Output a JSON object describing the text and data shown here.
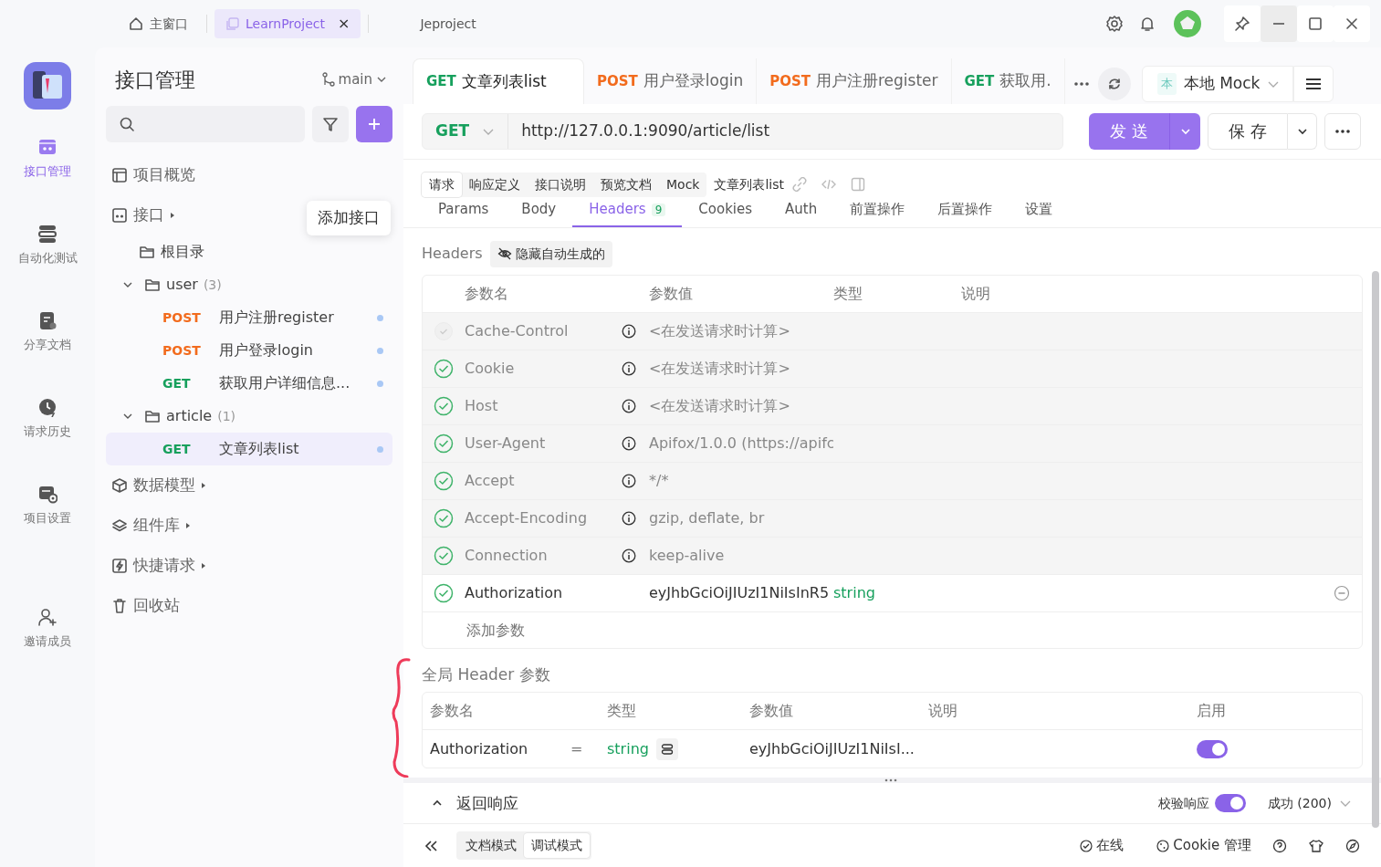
{
  "window_tabs": [
    {
      "label": "主窗口",
      "selected": false,
      "closable": false
    },
    {
      "label": "LearnProject",
      "selected": true,
      "closable": true
    },
    {
      "label": "Jeproject",
      "selected": false,
      "closable": false
    }
  ],
  "close_glyph": "×",
  "rail": [
    {
      "label": "接口管理",
      "selected": true
    },
    {
      "label": "自动化测试",
      "selected": false
    },
    {
      "label": "分享文档",
      "selected": false
    },
    {
      "label": "请求历史",
      "selected": false
    },
    {
      "label": "项目设置",
      "selected": false
    },
    {
      "label": "邀请成员",
      "selected": false
    }
  ],
  "tree_panel": {
    "title": "接口管理",
    "branch": "main",
    "tooltip": "添加接口",
    "sections": [
      {
        "label": "项目概览",
        "caret": false
      },
      {
        "label": "接口",
        "caret": true,
        "children": [
          {
            "kind": "folder",
            "label": "根目录"
          },
          {
            "kind": "folder",
            "label": "user",
            "count": "(3)",
            "expanded": true,
            "children": [
              {
                "kind": "endpoint",
                "method": "POST",
                "color": "#f26b1d",
                "label": "用户注册register",
                "selected": false
              },
              {
                "kind": "endpoint",
                "method": "POST",
                "color": "#f26b1d",
                "label": "用户登录login",
                "selected": false
              },
              {
                "kind": "endpoint",
                "method": "GET",
                "color": "#17a05d",
                "label": "获取用户详细信息...",
                "selected": false
              }
            ]
          },
          {
            "kind": "folder",
            "label": "article",
            "count": "(1)",
            "expanded": true,
            "children": [
              {
                "kind": "endpoint",
                "method": "GET",
                "color": "#17a05d",
                "label": "文章列表list",
                "selected": true
              }
            ]
          }
        ]
      },
      {
        "label": "数据模型",
        "caret": true
      },
      {
        "label": "组件库",
        "caret": true
      },
      {
        "label": "快捷请求",
        "caret": true
      },
      {
        "label": "回收站",
        "caret": false
      }
    ]
  },
  "request_tabs": [
    {
      "method": "GET",
      "color": "#17a05d",
      "label": "文章列表list",
      "selected": true
    },
    {
      "method": "POST",
      "color": "#f26b1d",
      "label": "用户登录login",
      "selected": false
    },
    {
      "method": "POST",
      "color": "#f26b1d",
      "label": "用户注册register",
      "selected": false
    },
    {
      "method": "GET",
      "color": "#17a05d",
      "label": "获取用.",
      "selected": false
    }
  ],
  "environment": {
    "badge": "本",
    "label": "本地 Mock"
  },
  "url_bar": {
    "method": "GET",
    "value": "http://127.0.0.1:9090/article/list",
    "send": "发 送",
    "save": "保 存"
  },
  "sub_tabs": [
    {
      "label": "请求",
      "selected": true
    },
    {
      "label": "响应定义",
      "selected": false
    },
    {
      "label": "接口说明",
      "selected": false
    },
    {
      "label": "预览文档",
      "selected": false
    },
    {
      "label": "Mock",
      "selected": false
    }
  ],
  "endpoint_title": "文章列表list",
  "param_tabs": [
    {
      "label": "Params",
      "selected": false
    },
    {
      "label": "Body",
      "selected": false
    },
    {
      "label": "Headers",
      "count": "9",
      "selected": true
    },
    {
      "label": "Cookies",
      "selected": false
    },
    {
      "label": "Auth",
      "selected": false
    },
    {
      "label": "前置操作",
      "selected": false
    },
    {
      "label": "后置操作",
      "selected": false
    },
    {
      "label": "设置",
      "selected": false
    }
  ],
  "headers": {
    "label": "Headers",
    "hide_button": "隐藏自动生成的",
    "columns": [
      "参数名",
      "参数值",
      "类型",
      "说明"
    ],
    "rows": [
      {
        "auto": true,
        "checked": false,
        "name": "Cache-Control",
        "value": "<在发送请求时计算>"
      },
      {
        "auto": true,
        "checked": true,
        "name": "Cookie",
        "value": "<在发送请求时计算>"
      },
      {
        "auto": true,
        "checked": true,
        "name": "Host",
        "value": "<在发送请求时计算>"
      },
      {
        "auto": true,
        "checked": true,
        "name": "User-Agent",
        "value": "Apifox/1.0.0 (https://apifc"
      },
      {
        "auto": true,
        "checked": true,
        "name": "Accept",
        "value": "*/*"
      },
      {
        "auto": true,
        "checked": true,
        "name": "Accept-Encoding",
        "value": "gzip, deflate, br"
      },
      {
        "auto": true,
        "checked": true,
        "name": "Connection",
        "value": "keep-alive"
      },
      {
        "auto": false,
        "checked": true,
        "name": "Authorization",
        "value": "eyJhbGciOiJIUzI1NiIsInR5",
        "type": "string"
      }
    ],
    "add_placeholder": "添加参数"
  },
  "global_headers": {
    "title": "全局 Header 参数",
    "columns": [
      "参数名",
      "类型",
      "参数值",
      "说明",
      "启用"
    ],
    "rows": [
      {
        "name": "Authorization",
        "operator": "=",
        "type": "string",
        "value": "eyJhbGciOiJIUzI1NiIsI...",
        "enabled": true
      }
    ]
  },
  "response": {
    "label": "返回响应",
    "validate_label": "校验响应",
    "validate_on": true,
    "status": "成功 (200)"
  },
  "footer": {
    "modes": [
      {
        "label": "文档模式",
        "selected": false
      },
      {
        "label": "调试模式",
        "selected": true
      }
    ],
    "online": "在线",
    "cookie": "Cookie 管理"
  }
}
